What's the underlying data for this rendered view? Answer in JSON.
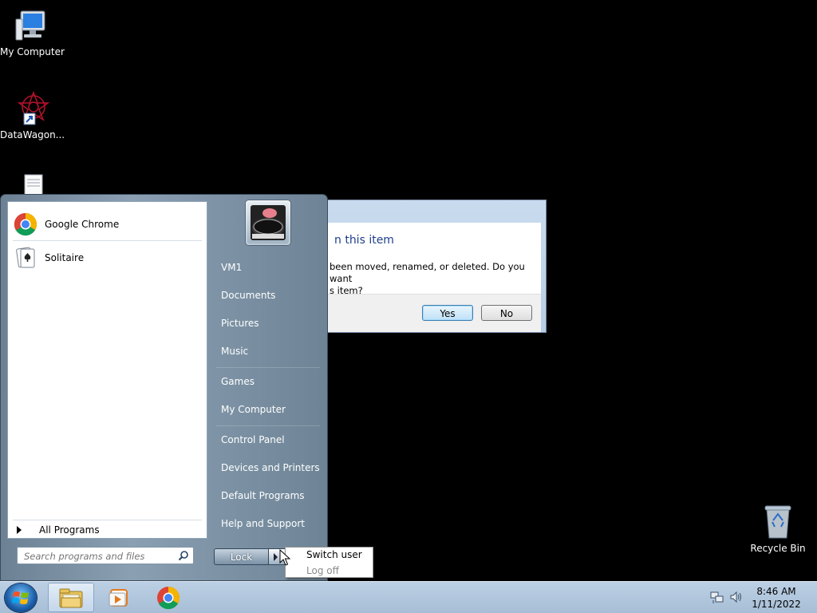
{
  "desktop": {
    "icons": [
      {
        "label": "My Computer",
        "icon": "computer-icon"
      },
      {
        "label": "DataWagon...",
        "icon": "datawagon-icon"
      },
      {
        "label": "",
        "icon": "text-file-icon"
      },
      {
        "label": "Recycle Bin",
        "icon": "recycle-bin-icon"
      }
    ]
  },
  "dialog": {
    "heading": "n this item",
    "message_line1": "been moved, renamed, or deleted. Do you want",
    "message_line2": "s item?",
    "yes_label": "Yes",
    "no_label": "No"
  },
  "start_menu": {
    "pinned_programs": [
      {
        "name": "Google Chrome",
        "icon": "chrome-icon"
      },
      {
        "name": "Solitaire",
        "icon": "solitaire-icon"
      }
    ],
    "all_programs_label": "All Programs",
    "search_placeholder": "Search programs and files",
    "user_name": "VM1",
    "right_items": [
      "Documents",
      "Pictures",
      "Music",
      "Games",
      "My Computer",
      "Control Panel",
      "Devices and Printers",
      "Default Programs",
      "Help and Support"
    ],
    "power_button_label": "Lock",
    "power_submenu": {
      "switch_user": "Switch user",
      "log_off": "Log off"
    }
  },
  "taskbar": {
    "pinned": [
      "windows-explorer-icon",
      "media-player-icon",
      "chrome-icon"
    ],
    "tray_icons": [
      "network-icon",
      "volume-icon"
    ],
    "time": "8:46 AM",
    "date": "1/11/2022"
  }
}
